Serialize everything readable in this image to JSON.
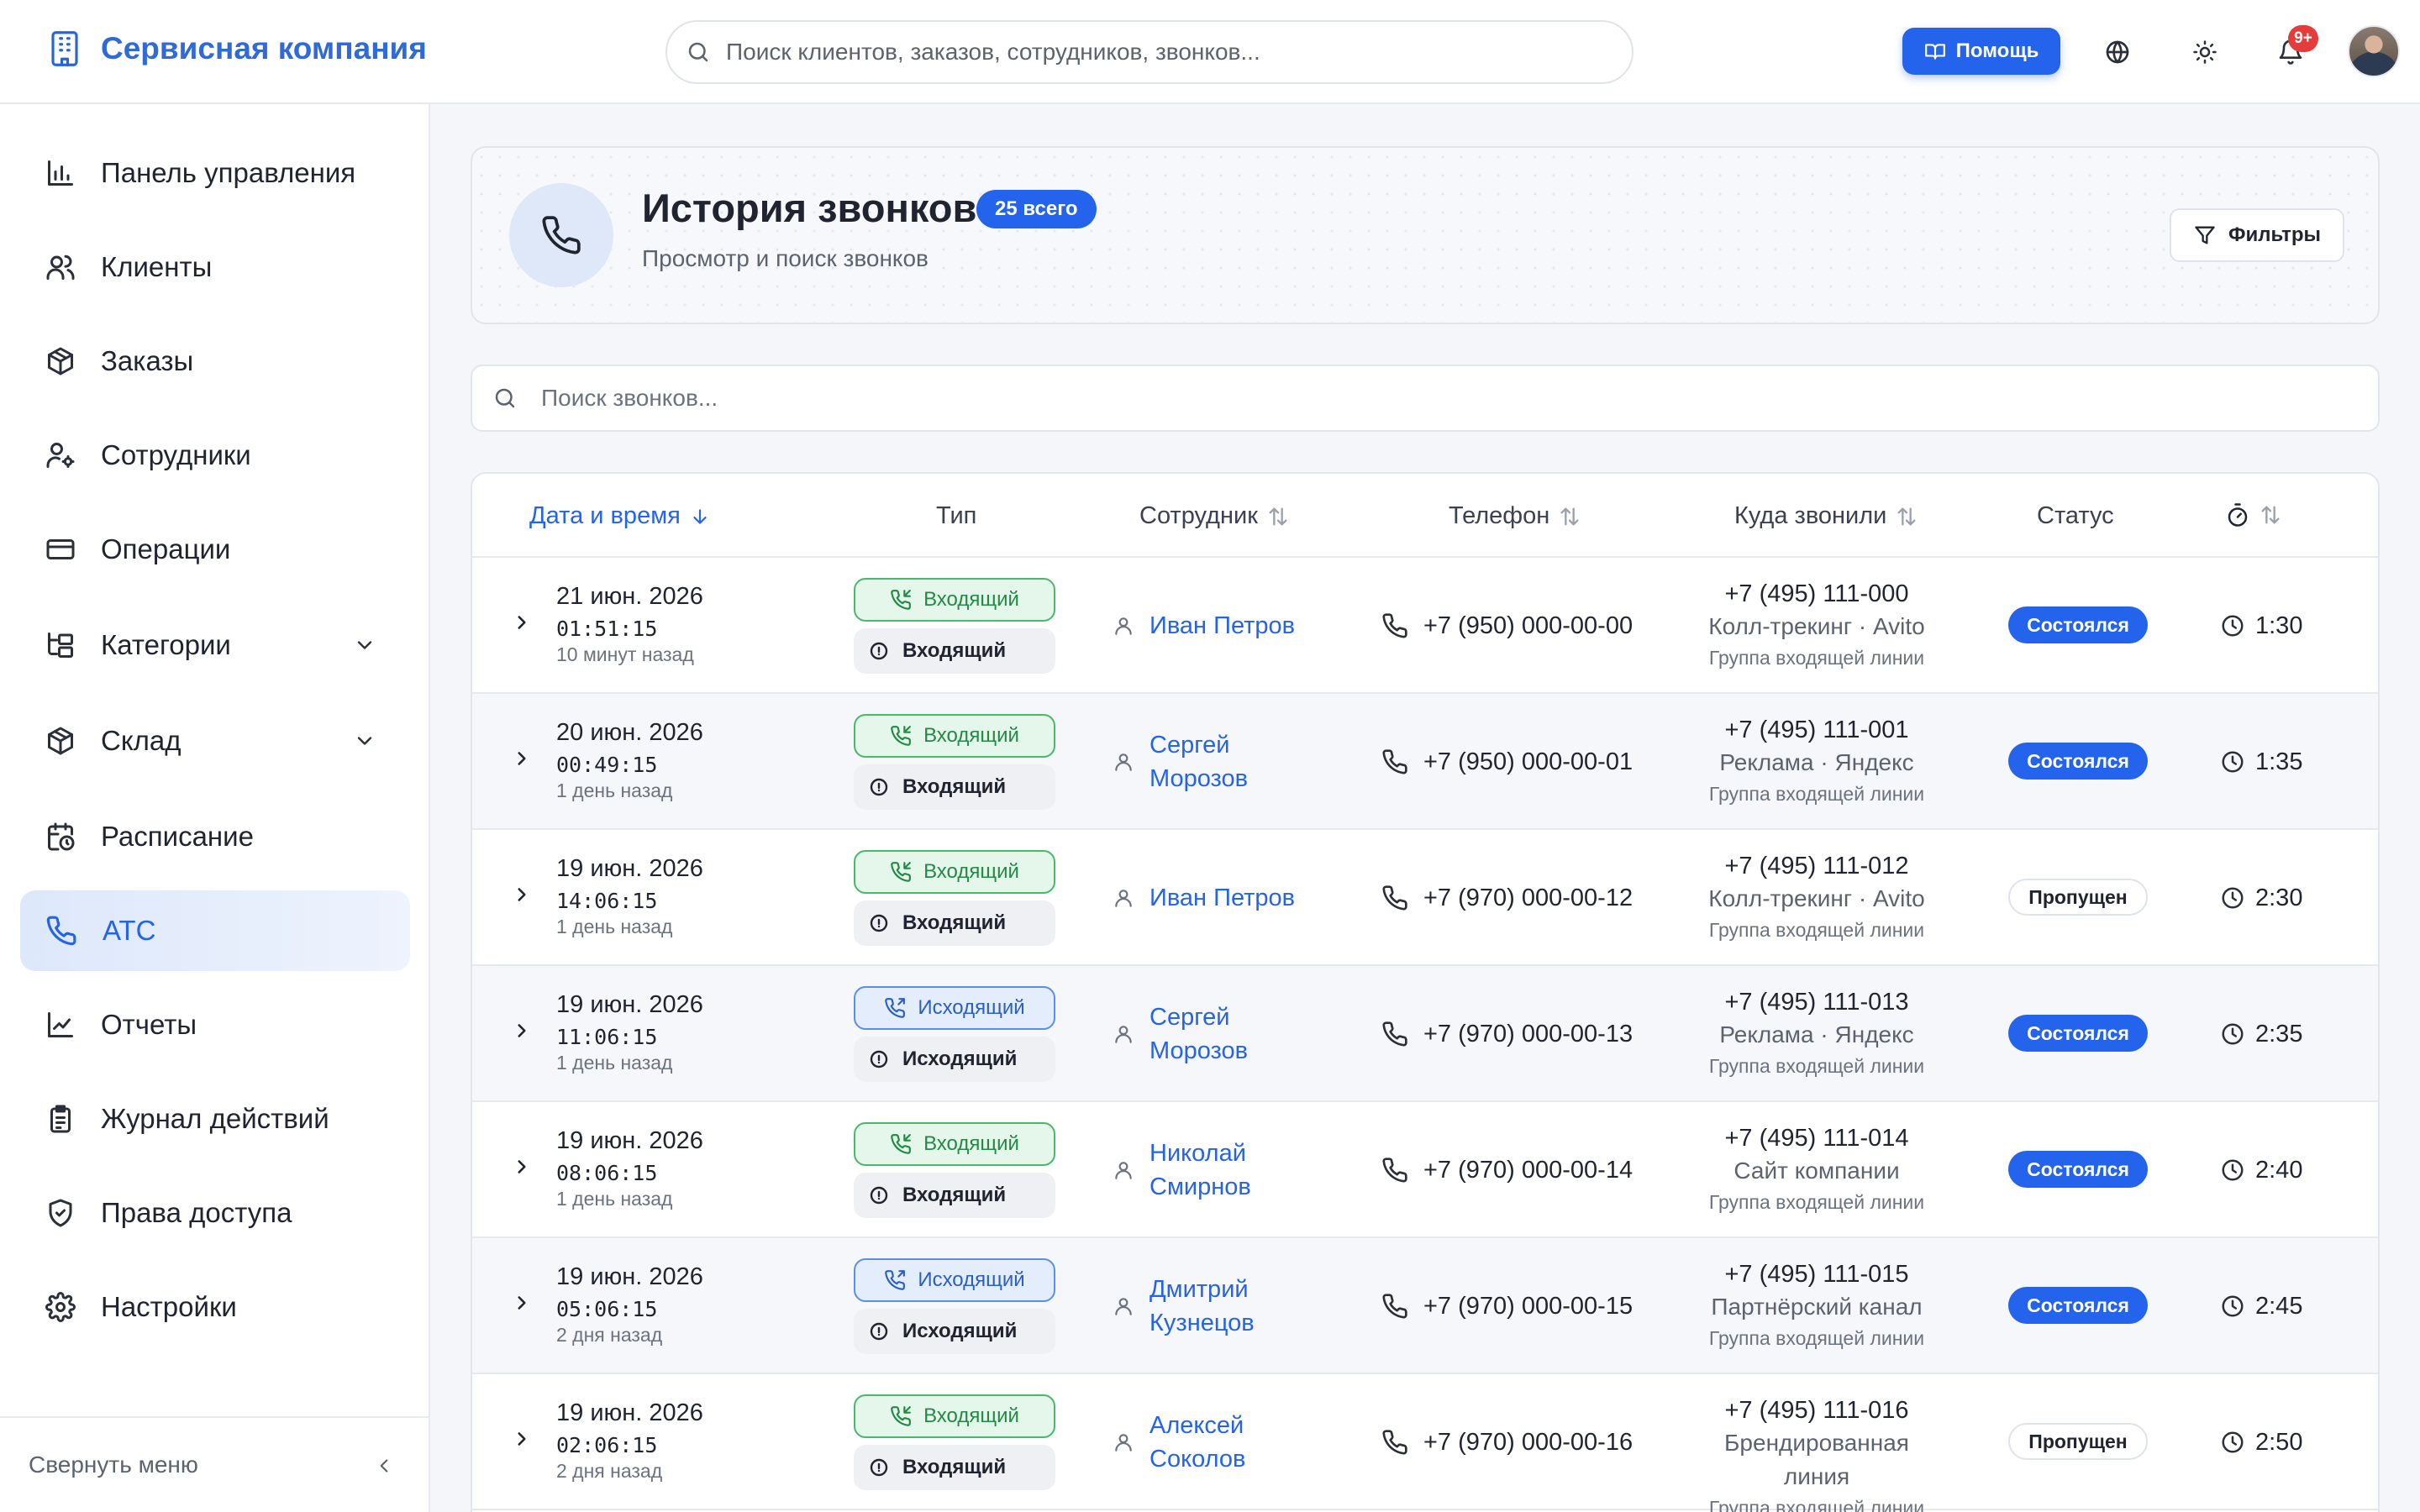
{
  "header": {
    "brand": "Сервисная компания",
    "search_placeholder": "Поиск клиентов, заказов, сотрудников, звонков...",
    "help_label": "Помощь",
    "notifications_badge": "9+"
  },
  "sidebar": {
    "items": [
      {
        "label": "Панель управления",
        "icon": "bar-chart-icon"
      },
      {
        "label": "Клиенты",
        "icon": "users-icon"
      },
      {
        "label": "Заказы",
        "icon": "package-icon"
      },
      {
        "label": "Сотрудники",
        "icon": "user-cog-icon"
      },
      {
        "label": "Операции",
        "icon": "credit-card-icon"
      },
      {
        "label": "Категории",
        "icon": "folder-tree-icon",
        "expandable": true
      },
      {
        "label": "Склад",
        "icon": "package-icon",
        "expandable": true
      },
      {
        "label": "Расписание",
        "icon": "calendar-clock-icon"
      },
      {
        "label": "АТС",
        "icon": "phone-icon",
        "active": true
      },
      {
        "label": "Отчеты",
        "icon": "line-chart-icon"
      },
      {
        "label": "Журнал действий",
        "icon": "clipboard-list-icon"
      },
      {
        "label": "Права доступа",
        "icon": "shield-check-icon"
      },
      {
        "label": "Настройки",
        "icon": "gear-icon"
      }
    ],
    "collapse_label": "Свернуть меню"
  },
  "page": {
    "title": "История звонков",
    "count_badge": "25 всего",
    "subtitle": "Просмотр и поиск звонков",
    "filters_label": "Фильтры",
    "search_placeholder": "Поиск звонков..."
  },
  "table": {
    "columns": {
      "datetime": "Дата и время",
      "type": "Тип",
      "employee": "Сотрудник",
      "phone": "Телефон",
      "destination": "Куда звонили",
      "status": "Статус"
    },
    "rows": [
      {
        "date": "21 июн. 2026",
        "time": "01:51:15",
        "relative": "10 минут назад",
        "type": "Входящий",
        "direction": "in",
        "type_sub": "Входящий",
        "employee_first": "Иван Петров",
        "employee_last": "",
        "phone": "+7 (950) 000-00-00",
        "dest_number": "+7 (495) 111-000",
        "dest_source": "Колл-трекинг · Avito",
        "dest_source_2": "",
        "dest_line": "Группа входящей линии",
        "status": "Состоялся",
        "status_kind": "ok",
        "duration": "1:30"
      },
      {
        "date": "20 июн. 2026",
        "time": "00:49:15",
        "relative": "1 день назад",
        "type": "Входящий",
        "direction": "in",
        "type_sub": "Входящий",
        "employee_first": "Сергей",
        "employee_last": "Морозов",
        "phone": "+7 (950) 000-00-01",
        "dest_number": "+7 (495) 111-001",
        "dest_source": "Реклама · Яндекс",
        "dest_source_2": "",
        "dest_line": "Группа входящей линии",
        "status": "Состоялся",
        "status_kind": "ok",
        "duration": "1:35"
      },
      {
        "date": "19 июн. 2026",
        "time": "14:06:15",
        "relative": "1 день назад",
        "type": "Входящий",
        "direction": "in",
        "type_sub": "Входящий",
        "employee_first": "Иван Петров",
        "employee_last": "",
        "phone": "+7 (970) 000-00-12",
        "dest_number": "+7 (495) 111-012",
        "dest_source": "Колл-трекинг · Avito",
        "dest_source_2": "",
        "dest_line": "Группа входящей линии",
        "status": "Пропущен",
        "status_kind": "miss",
        "duration": "2:30"
      },
      {
        "date": "19 июн. 2026",
        "time": "11:06:15",
        "relative": "1 день назад",
        "type": "Исходящий",
        "direction": "out",
        "type_sub": "Исходящий",
        "employee_first": "Сергей",
        "employee_last": "Морозов",
        "phone": "+7 (970) 000-00-13",
        "dest_number": "+7 (495) 111-013",
        "dest_source": "Реклама · Яндекс",
        "dest_source_2": "",
        "dest_line": "Группа входящей линии",
        "status": "Состоялся",
        "status_kind": "ok",
        "duration": "2:35"
      },
      {
        "date": "19 июн. 2026",
        "time": "08:06:15",
        "relative": "1 день назад",
        "type": "Входящий",
        "direction": "in",
        "type_sub": "Входящий",
        "employee_first": "Николай",
        "employee_last": "Смирнов",
        "phone": "+7 (970) 000-00-14",
        "dest_number": "+7 (495) 111-014",
        "dest_source": "Сайт компании",
        "dest_source_2": "",
        "dest_line": "Группа входящей линии",
        "status": "Состоялся",
        "status_kind": "ok",
        "duration": "2:40"
      },
      {
        "date": "19 июн. 2026",
        "time": "05:06:15",
        "relative": "2 дня назад",
        "type": "Исходящий",
        "direction": "out",
        "type_sub": "Исходящий",
        "employee_first": "Дмитрий",
        "employee_last": "Кузнецов",
        "phone": "+7 (970) 000-00-15",
        "dest_number": "+7 (495) 111-015",
        "dest_source": "Партнёрский канал",
        "dest_source_2": "",
        "dest_line": "Группа входящей линии",
        "status": "Состоялся",
        "status_kind": "ok",
        "duration": "2:45"
      },
      {
        "date": "19 июн. 2026",
        "time": "02:06:15",
        "relative": "2 дня назад",
        "type": "Входящий",
        "direction": "in",
        "type_sub": "Входящий",
        "employee_first": "Алексей",
        "employee_last": "Соколов",
        "phone": "+7 (970) 000-00-16",
        "dest_number": "+7 (495) 111-016",
        "dest_source": "Брендированная",
        "dest_source_2": "линия",
        "dest_line": "Группа входящей линии",
        "status": "Пропущен",
        "status_kind": "miss",
        "duration": "2:50"
      }
    ]
  },
  "colors": {
    "accent": "#2463eb",
    "brand_text": "#2f6ad9",
    "incoming_green": "#238a45",
    "outgoing_blue": "#2a5fc7",
    "badge_red": "#e43b3b"
  }
}
